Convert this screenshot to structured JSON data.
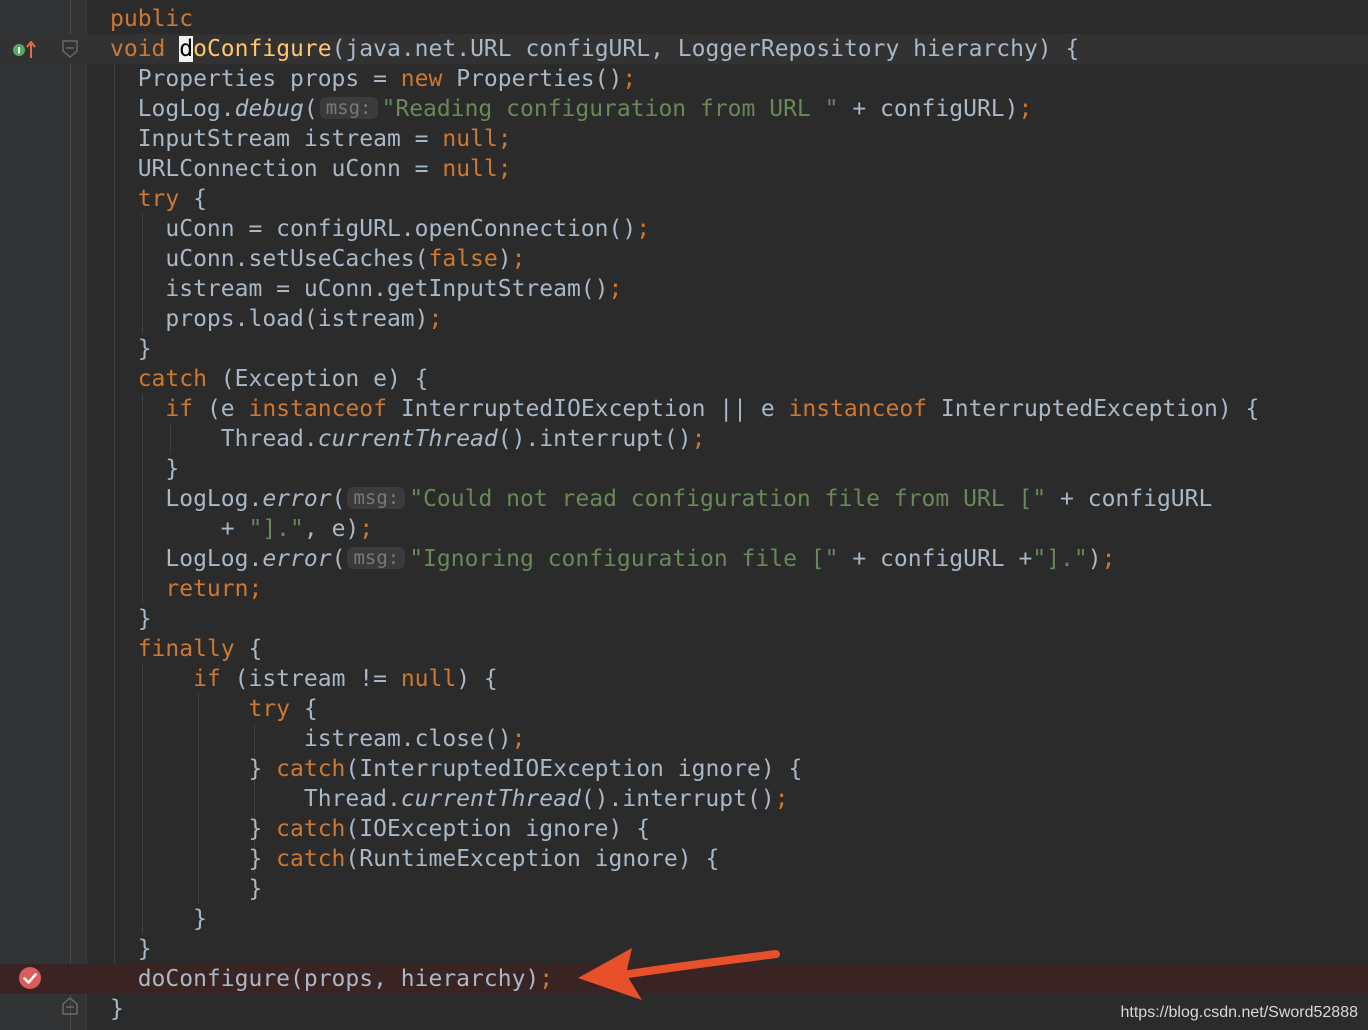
{
  "editor": {
    "lines": [
      {
        "code": [
          {
            "t": "public",
            "c": "kw"
          }
        ]
      },
      {
        "current": true,
        "code": [
          {
            "t": "void ",
            "c": "kw"
          },
          {
            "t": "d",
            "c": "method caret-word"
          },
          {
            "t": "oConfigure",
            "c": "method"
          },
          {
            "t": "(java.net.URL configURL, LoggerRepository hierarchy) {"
          }
        ]
      },
      {
        "code": [
          {
            "t": "  Properties props = "
          },
          {
            "t": "new ",
            "c": "kw"
          },
          {
            "t": "Properties()"
          },
          {
            "t": ";",
            "c": "semi"
          }
        ]
      },
      {
        "code": [
          {
            "t": "  LogLog."
          },
          {
            "t": "debug",
            "c": "italic"
          },
          {
            "t": "("
          },
          {
            "t": "msg:",
            "c": "hint"
          },
          {
            "t": "\"Reading configuration from URL \"",
            "c": "str"
          },
          {
            "t": " + configURL)"
          },
          {
            "t": ";",
            "c": "semi"
          }
        ]
      },
      {
        "code": [
          {
            "t": "  InputStream istream = "
          },
          {
            "t": "null",
            "c": "kw"
          },
          {
            "t": ";",
            "c": "semi"
          }
        ]
      },
      {
        "code": [
          {
            "t": "  URLConnection uConn = "
          },
          {
            "t": "null",
            "c": "kw"
          },
          {
            "t": ";",
            "c": "semi"
          }
        ]
      },
      {
        "code": [
          {
            "t": "  "
          },
          {
            "t": "try",
            "c": "kw"
          },
          {
            "t": " {"
          }
        ]
      },
      {
        "code": [
          {
            "t": "    uConn = configURL.openConnection()"
          },
          {
            "t": ";",
            "c": "semi"
          }
        ]
      },
      {
        "code": [
          {
            "t": "    uConn.setUseCaches("
          },
          {
            "t": "false",
            "c": "kw"
          },
          {
            "t": ")"
          },
          {
            "t": ";",
            "c": "semi"
          }
        ]
      },
      {
        "code": [
          {
            "t": "    istream = uConn.getInputStream()"
          },
          {
            "t": ";",
            "c": "semi"
          }
        ]
      },
      {
        "code": [
          {
            "t": "    props.load(istream)"
          },
          {
            "t": ";",
            "c": "semi"
          }
        ]
      },
      {
        "code": [
          {
            "t": "  }"
          }
        ]
      },
      {
        "code": [
          {
            "t": "  "
          },
          {
            "t": "catch",
            "c": "kw"
          },
          {
            "t": " (Exception e) {"
          }
        ]
      },
      {
        "code": [
          {
            "t": "    "
          },
          {
            "t": "if",
            "c": "kw"
          },
          {
            "t": " (e "
          },
          {
            "t": "instanceof",
            "c": "kw"
          },
          {
            "t": " InterruptedIOException || e "
          },
          {
            "t": "instanceof",
            "c": "kw"
          },
          {
            "t": " InterruptedException) {"
          }
        ]
      },
      {
        "code": [
          {
            "t": "        Thread."
          },
          {
            "t": "currentThread",
            "c": "italic"
          },
          {
            "t": "().interrupt()"
          },
          {
            "t": ";",
            "c": "semi"
          }
        ]
      },
      {
        "code": [
          {
            "t": "    }"
          }
        ]
      },
      {
        "code": [
          {
            "t": "    LogLog."
          },
          {
            "t": "error",
            "c": "italic"
          },
          {
            "t": "("
          },
          {
            "t": "msg:",
            "c": "hint"
          },
          {
            "t": "\"Could not read configuration file from URL [\"",
            "c": "str"
          },
          {
            "t": " + configURL"
          }
        ]
      },
      {
        "code": [
          {
            "t": "        + "
          },
          {
            "t": "\"].\"",
            "c": "str"
          },
          {
            "t": ", e)"
          },
          {
            "t": ";",
            "c": "semi"
          }
        ]
      },
      {
        "code": [
          {
            "t": "    LogLog."
          },
          {
            "t": "error",
            "c": "italic"
          },
          {
            "t": "("
          },
          {
            "t": "msg:",
            "c": "hint"
          },
          {
            "t": "\"Ignoring configuration file [\"",
            "c": "str"
          },
          {
            "t": " + configURL +"
          },
          {
            "t": "\"].\"",
            "c": "str"
          },
          {
            "t": ")"
          },
          {
            "t": ";",
            "c": "semi"
          }
        ]
      },
      {
        "code": [
          {
            "t": "    "
          },
          {
            "t": "return",
            "c": "kw"
          },
          {
            "t": ";",
            "c": "semi"
          }
        ]
      },
      {
        "code": [
          {
            "t": "  }"
          }
        ]
      },
      {
        "code": [
          {
            "t": "  "
          },
          {
            "t": "finally",
            "c": "kw"
          },
          {
            "t": " {"
          }
        ]
      },
      {
        "code": [
          {
            "t": "      "
          },
          {
            "t": "if",
            "c": "kw"
          },
          {
            "t": " (istream != "
          },
          {
            "t": "null",
            "c": "kw"
          },
          {
            "t": ") {"
          }
        ]
      },
      {
        "code": [
          {
            "t": "          "
          },
          {
            "t": "try",
            "c": "kw"
          },
          {
            "t": " {"
          }
        ]
      },
      {
        "code": [
          {
            "t": "              istream.close()"
          },
          {
            "t": ";",
            "c": "semi"
          }
        ]
      },
      {
        "code": [
          {
            "t": "          } "
          },
          {
            "t": "catch",
            "c": "kw"
          },
          {
            "t": "(InterruptedIOException ignore) {"
          }
        ]
      },
      {
        "code": [
          {
            "t": "              Thread."
          },
          {
            "t": "currentThread",
            "c": "italic"
          },
          {
            "t": "().interrupt()"
          },
          {
            "t": ";",
            "c": "semi"
          }
        ]
      },
      {
        "code": [
          {
            "t": "          } "
          },
          {
            "t": "catch",
            "c": "kw"
          },
          {
            "t": "(IOException ignore) {"
          }
        ]
      },
      {
        "code": [
          {
            "t": "          } "
          },
          {
            "t": "catch",
            "c": "kw"
          },
          {
            "t": "(RuntimeException ignore) {"
          }
        ]
      },
      {
        "code": [
          {
            "t": "          }"
          }
        ]
      },
      {
        "code": [
          {
            "t": "      }"
          }
        ]
      },
      {
        "code": [
          {
            "t": "  }"
          }
        ]
      },
      {
        "breakpoint": true,
        "code": [
          {
            "t": "  doConfigure(props, hierarchy)"
          },
          {
            "t": ";",
            "c": "semi"
          }
        ]
      },
      {
        "code": [
          {
            "t": "}"
          }
        ]
      }
    ]
  },
  "colors": {
    "background": "#2b2b2b",
    "keyword": "#cc7832",
    "string": "#6a8759",
    "method_declaration": "#ffc66d",
    "plain": "#a9b7c6",
    "breakpoint_line": "#3a2323",
    "arrow": "#e8502c"
  },
  "icons": {
    "override_marker": "implements-up-arrow-icon",
    "breakpoint": "breakpoint-check-icon",
    "fold": "fold-marker-icon"
  },
  "watermark": "https://blog.csdn.net/Sword52888"
}
